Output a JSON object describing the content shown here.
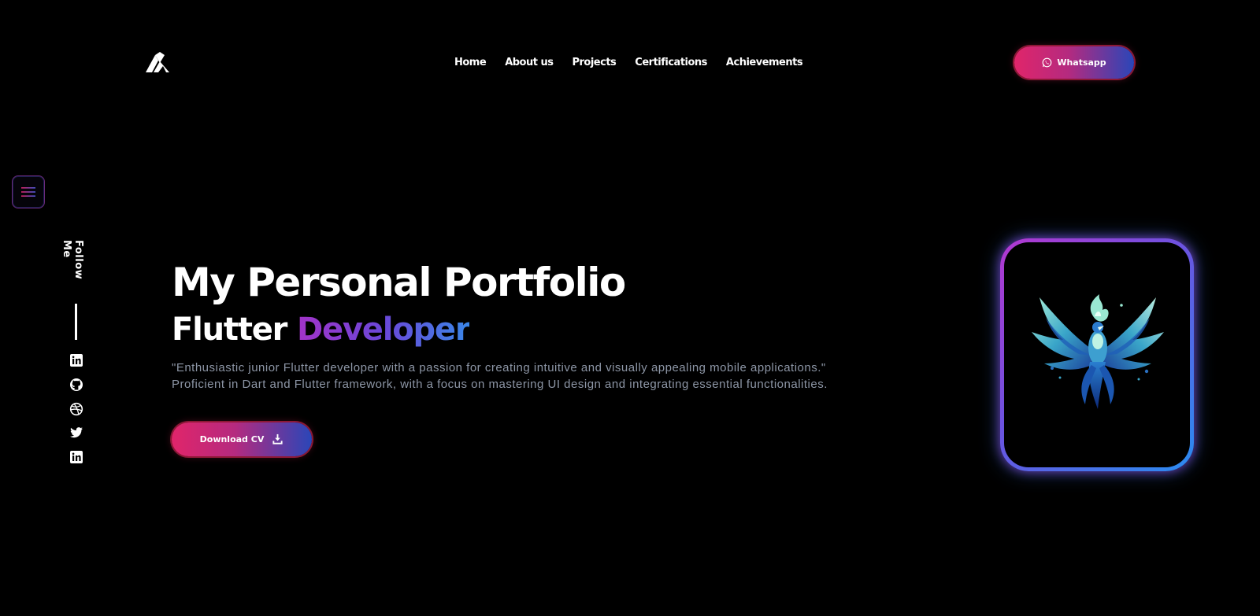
{
  "header": {
    "logo": "logo-mark",
    "nav": [
      {
        "label": "Home"
      },
      {
        "label": "About us"
      },
      {
        "label": "Projects"
      },
      {
        "label": "Certifications"
      },
      {
        "label": "Achievements"
      }
    ],
    "whatsapp_label": "Whatsapp"
  },
  "sidebar": {
    "menu_icon": "hamburger-icon",
    "follow_label": "Follow Me",
    "socials": [
      {
        "icon": "linkedin-icon"
      },
      {
        "icon": "github-icon"
      },
      {
        "icon": "dribbble-icon"
      },
      {
        "icon": "twitter-icon"
      },
      {
        "icon": "linkedin-icon"
      }
    ]
  },
  "hero": {
    "title": "My Personal Portfolio",
    "role_prefix": "Flutter",
    "role_accent": "Developer",
    "description_line1": "\"Enthusiastic junior Flutter developer with a passion for creating intuitive and visually appealing mobile applications.\"",
    "description_line2": " Proficient in Dart and Flutter framework, with a focus on mastering UI design and integrating essential functionalities.",
    "cv_label": "Download CV"
  },
  "colors": {
    "background": "#000000",
    "accent_pink": "#e0256a",
    "accent_blue": "#2a46b8",
    "accent_purple": "#a233c8",
    "text_muted": "#8d96a6"
  }
}
